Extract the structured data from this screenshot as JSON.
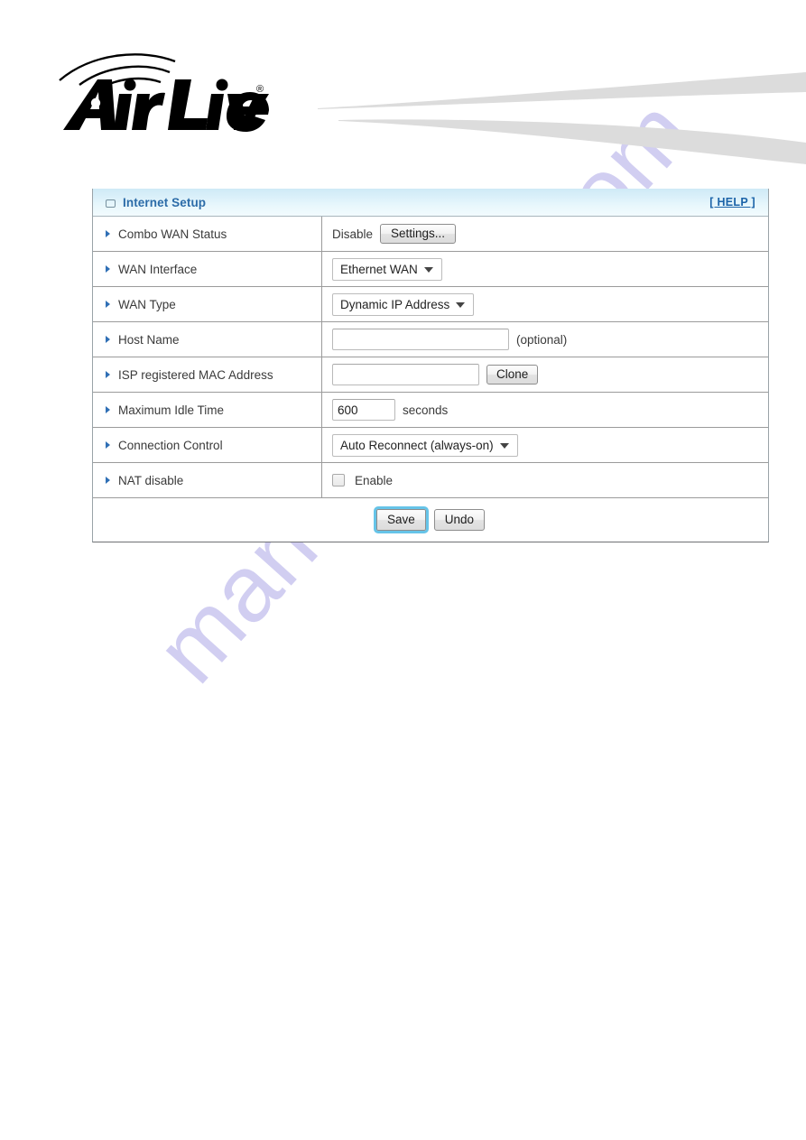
{
  "brand": {
    "name": "AirLive",
    "word_air": "Air",
    "word_live": "Live",
    "trademark": "®"
  },
  "watermark": {
    "text": "manualshive.com",
    "color": "#c9c6ef"
  },
  "panel": {
    "icon": "window-icon",
    "title": "Internet Setup",
    "help_label": "[ HELP ]",
    "title_color": "#2c6ca8",
    "help_color": "#1b63a8",
    "header_gradient_top": "#cfeaf6",
    "header_gradient_bottom": "#f2fbfe"
  },
  "rows": [
    {
      "key": "combo-wan-status",
      "label": "Combo WAN Status",
      "control": "text-and-button",
      "value_text": "Disable",
      "button_label": "Settings..."
    },
    {
      "key": "wan-interface",
      "label": "WAN Interface",
      "control": "select",
      "selected": "Ethernet WAN"
    },
    {
      "key": "wan-type",
      "label": "WAN Type",
      "control": "select",
      "selected": "Dynamic IP Address"
    },
    {
      "key": "host-name",
      "label": "Host Name",
      "control": "text-input",
      "value": "",
      "suffix": "(optional)"
    },
    {
      "key": "isp-registered-mac-address",
      "label": "ISP registered MAC Address",
      "control": "text-input-with-button",
      "value": "",
      "button_label": "Clone"
    },
    {
      "key": "maximum-idle-time",
      "label": "Maximum Idle Time",
      "control": "text-input",
      "value": "600",
      "suffix": "seconds"
    },
    {
      "key": "connection-control",
      "label": "Connection Control",
      "control": "select",
      "selected": "Auto Reconnect (always-on)"
    },
    {
      "key": "nat-disable",
      "label": "NAT disable",
      "control": "checkbox",
      "checkbox_label": "Enable",
      "checked": false
    }
  ],
  "footer": {
    "save_label": "Save",
    "undo_label": "Undo",
    "save_focus_color": "#66c4e8"
  }
}
